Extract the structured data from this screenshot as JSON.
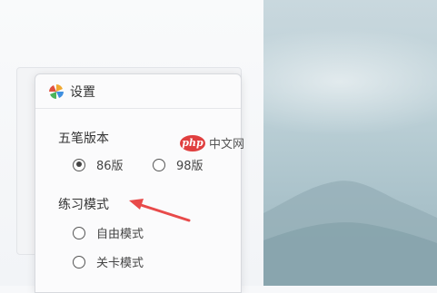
{
  "dialog": {
    "title": "设置",
    "version_section": {
      "label": "五笔版本",
      "options": [
        {
          "label": "86版",
          "selected": true
        },
        {
          "label": "98版",
          "selected": false
        }
      ]
    },
    "practice_section": {
      "label": "练习模式",
      "options": [
        {
          "label": "自由模式",
          "selected": false
        },
        {
          "label": "关卡模式",
          "selected": false
        }
      ]
    }
  },
  "watermark": {
    "logo_text": "php",
    "site_text": "中文网"
  },
  "annotation": {
    "arrow_color": "#e84a4a",
    "icon": "arrow-pointing-left"
  },
  "colors": {
    "accent": "#e84a4a",
    "desktop_right": "#b8cdd4"
  }
}
